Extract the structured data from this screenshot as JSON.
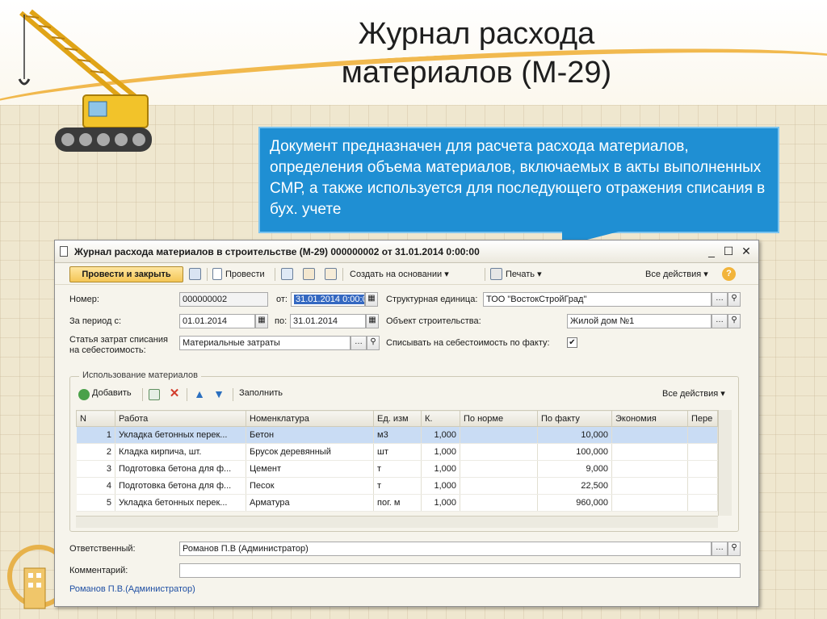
{
  "slide": {
    "title_line1": "Журнал расхода",
    "title_line2": "материалов (М-29)",
    "callout_text": "Документ предназначен для расчета расхода материалов, определения объема материалов, включаемых в акты выполненных СМР, а также используется для последующего отражения списания в бух. учете"
  },
  "window": {
    "title": "Журнал расхода материалов в строительстве (М-29) 000000002 от 31.01.2014 0:00:00",
    "minimize": "_",
    "maximize": "☐",
    "close": "✕"
  },
  "toolbar": {
    "post_close": "Провести и закрыть",
    "post": "Провести",
    "create_based": "Создать на основании",
    "print": "Печать",
    "all_actions": "Все действия",
    "help": "?"
  },
  "form": {
    "number_label": "Номер:",
    "number_value": "000000002",
    "from_label": "от:",
    "from_value": "31.01.2014  0:00:00",
    "period_label": "За период с:",
    "period_from": "01.01.2014",
    "period_to_label": "по:",
    "period_to": "31.01.2014",
    "cost_item_label_1": "Статья затрат списания",
    "cost_item_label_2": "на себестоимость:",
    "cost_item_value": "Материальные затраты",
    "unit_label": "Структурная единица:",
    "unit_value": "ТОО \"ВостокСтройГрад\"",
    "object_label": "Объект строительства:",
    "object_value": "Жилой дом №1",
    "writeoff_label": "Списывать на себестоимость по факту:",
    "writeoff_checked": "✔"
  },
  "materials": {
    "group_title": "Использование материалов",
    "add": "Добавить",
    "fill": "Заполнить",
    "all_actions": "Все действия",
    "columns": [
      "N",
      "Работа",
      "Номенклатура",
      "Ед. изм",
      "К.",
      "По норме",
      "По факту",
      "Экономия",
      "Пере"
    ],
    "rows": [
      {
        "n": "1",
        "work": "Укладка бетонных перек...",
        "item": "Бетон",
        "unit": "м3",
        "k": "1,000",
        "norm": "",
        "fact": "10,000",
        "saving": ""
      },
      {
        "n": "2",
        "work": "Кладка кирпича, шт.",
        "item": "Брусок деревянный",
        "unit": "шт",
        "k": "1,000",
        "norm": "",
        "fact": "100,000",
        "saving": ""
      },
      {
        "n": "3",
        "work": "Подготовка бетона для ф...",
        "item": "Цемент",
        "unit": "т",
        "k": "1,000",
        "norm": "",
        "fact": "9,000",
        "saving": ""
      },
      {
        "n": "4",
        "work": "Подготовка бетона для ф...",
        "item": "Песок",
        "unit": "т",
        "k": "1,000",
        "norm": "",
        "fact": "22,500",
        "saving": ""
      },
      {
        "n": "5",
        "work": "Укладка бетонных перек...",
        "item": "Арматура",
        "unit": "пог. м",
        "k": "1,000",
        "norm": "",
        "fact": "960,000",
        "saving": ""
      }
    ]
  },
  "bottom": {
    "responsible_label": "Ответственный:",
    "responsible_value": "Романов П.В (Администратор)",
    "comment_label": "Комментарий:",
    "comment_value": "",
    "author_link": "Романов П.В.(Администратор)"
  },
  "colors": {
    "callout": "#1f8fd3",
    "primary_button": "#f4c656",
    "selected_row": "#c9dcf4",
    "link": "#1f4fa3"
  }
}
